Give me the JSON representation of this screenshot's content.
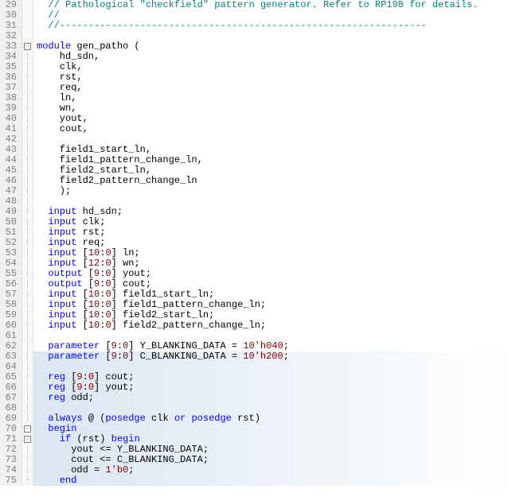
{
  "lines": [
    {
      "n": 29,
      "fold": "",
      "segs": [
        {
          "cls": "comment",
          "t": "  // Pathological \"checkfield\" pattern generator. Refer to RP198 for details."
        }
      ]
    },
    {
      "n": 30,
      "fold": "",
      "segs": [
        {
          "cls": "comment",
          "t": "  //"
        }
      ]
    },
    {
      "n": 31,
      "fold": "",
      "segs": [
        {
          "cls": "comment",
          "t": "  //----------------------------------------------------------------"
        }
      ]
    },
    {
      "n": 32,
      "fold": "",
      "segs": [
        {
          "cls": "",
          "t": ""
        }
      ]
    },
    {
      "n": 33,
      "fold": "minus",
      "segs": [
        {
          "cls": "keyword",
          "t": "module"
        },
        {
          "cls": "ident",
          "t": " gen_patho ("
        }
      ]
    },
    {
      "n": 34,
      "fold": "bar",
      "segs": [
        {
          "cls": "ident",
          "t": "    hd_sdn,"
        }
      ]
    },
    {
      "n": 35,
      "fold": "bar",
      "segs": [
        {
          "cls": "ident",
          "t": "    clk,"
        }
      ]
    },
    {
      "n": 36,
      "fold": "bar",
      "segs": [
        {
          "cls": "ident",
          "t": "    rst,"
        }
      ]
    },
    {
      "n": 37,
      "fold": "bar",
      "segs": [
        {
          "cls": "ident",
          "t": "    req,"
        }
      ]
    },
    {
      "n": 38,
      "fold": "bar",
      "segs": [
        {
          "cls": "ident",
          "t": "    ln,"
        }
      ]
    },
    {
      "n": 39,
      "fold": "bar",
      "segs": [
        {
          "cls": "ident",
          "t": "    wn,"
        }
      ]
    },
    {
      "n": 40,
      "fold": "bar",
      "segs": [
        {
          "cls": "ident",
          "t": "    yout,"
        }
      ]
    },
    {
      "n": 41,
      "fold": "bar",
      "segs": [
        {
          "cls": "ident",
          "t": "    cout,"
        }
      ]
    },
    {
      "n": 42,
      "fold": "bar",
      "segs": [
        {
          "cls": "",
          "t": ""
        }
      ]
    },
    {
      "n": 43,
      "fold": "bar",
      "segs": [
        {
          "cls": "ident",
          "t": "    field1_start_ln,"
        }
      ]
    },
    {
      "n": 44,
      "fold": "bar",
      "segs": [
        {
          "cls": "ident",
          "t": "    field1_pattern_change_ln,"
        }
      ]
    },
    {
      "n": 45,
      "fold": "bar",
      "segs": [
        {
          "cls": "ident",
          "t": "    field2_start_ln,"
        }
      ]
    },
    {
      "n": 46,
      "fold": "bar",
      "segs": [
        {
          "cls": "ident",
          "t": "    field2_pattern_change_ln"
        }
      ]
    },
    {
      "n": 47,
      "fold": "bar",
      "segs": [
        {
          "cls": "ident",
          "t": "    );"
        }
      ]
    },
    {
      "n": 48,
      "fold": "bar",
      "segs": [
        {
          "cls": "",
          "t": ""
        }
      ]
    },
    {
      "n": 49,
      "fold": "bar",
      "segs": [
        {
          "cls": "keyword",
          "t": "  input"
        },
        {
          "cls": "ident",
          "t": " hd_sdn;"
        }
      ]
    },
    {
      "n": 50,
      "fold": "bar",
      "segs": [
        {
          "cls": "keyword",
          "t": "  input"
        },
        {
          "cls": "ident",
          "t": " clk;"
        }
      ]
    },
    {
      "n": 51,
      "fold": "bar",
      "segs": [
        {
          "cls": "keyword",
          "t": "  input"
        },
        {
          "cls": "ident",
          "t": " rst;"
        }
      ]
    },
    {
      "n": 52,
      "fold": "bar",
      "segs": [
        {
          "cls": "keyword",
          "t": "  input"
        },
        {
          "cls": "ident",
          "t": " req;"
        }
      ]
    },
    {
      "n": 53,
      "fold": "bar",
      "segs": [
        {
          "cls": "keyword",
          "t": "  input"
        },
        {
          "cls": "ident",
          "t": " ["
        },
        {
          "cls": "number",
          "t": "10"
        },
        {
          "cls": "ident",
          "t": ":"
        },
        {
          "cls": "number",
          "t": "0"
        },
        {
          "cls": "ident",
          "t": "] ln;"
        }
      ]
    },
    {
      "n": 54,
      "fold": "bar",
      "segs": [
        {
          "cls": "keyword",
          "t": "  input"
        },
        {
          "cls": "ident",
          "t": " ["
        },
        {
          "cls": "number",
          "t": "12"
        },
        {
          "cls": "ident",
          "t": ":"
        },
        {
          "cls": "number",
          "t": "0"
        },
        {
          "cls": "ident",
          "t": "] wn;"
        }
      ]
    },
    {
      "n": 55,
      "fold": "bar",
      "segs": [
        {
          "cls": "keyword",
          "t": "  output"
        },
        {
          "cls": "ident",
          "t": " ["
        },
        {
          "cls": "number",
          "t": "9"
        },
        {
          "cls": "ident",
          "t": ":"
        },
        {
          "cls": "number",
          "t": "0"
        },
        {
          "cls": "ident",
          "t": "] yout;"
        }
      ]
    },
    {
      "n": 56,
      "fold": "bar",
      "segs": [
        {
          "cls": "keyword",
          "t": "  output"
        },
        {
          "cls": "ident",
          "t": " ["
        },
        {
          "cls": "number",
          "t": "9"
        },
        {
          "cls": "ident",
          "t": ":"
        },
        {
          "cls": "number",
          "t": "0"
        },
        {
          "cls": "ident",
          "t": "] cout;"
        }
      ]
    },
    {
      "n": 57,
      "fold": "bar",
      "segs": [
        {
          "cls": "keyword",
          "t": "  input"
        },
        {
          "cls": "ident",
          "t": " ["
        },
        {
          "cls": "number",
          "t": "10"
        },
        {
          "cls": "ident",
          "t": ":"
        },
        {
          "cls": "number",
          "t": "0"
        },
        {
          "cls": "ident",
          "t": "] field1_start_ln;"
        }
      ]
    },
    {
      "n": 58,
      "fold": "bar",
      "segs": [
        {
          "cls": "keyword",
          "t": "  input"
        },
        {
          "cls": "ident",
          "t": " ["
        },
        {
          "cls": "number",
          "t": "10"
        },
        {
          "cls": "ident",
          "t": ":"
        },
        {
          "cls": "number",
          "t": "0"
        },
        {
          "cls": "ident",
          "t": "] field1_pattern_change_ln;"
        }
      ]
    },
    {
      "n": 59,
      "fold": "bar",
      "segs": [
        {
          "cls": "keyword",
          "t": "  input"
        },
        {
          "cls": "ident",
          "t": " ["
        },
        {
          "cls": "number",
          "t": "10"
        },
        {
          "cls": "ident",
          "t": ":"
        },
        {
          "cls": "number",
          "t": "0"
        },
        {
          "cls": "ident",
          "t": "] field2_start_ln;"
        }
      ]
    },
    {
      "n": 60,
      "fold": "bar",
      "segs": [
        {
          "cls": "keyword",
          "t": "  input"
        },
        {
          "cls": "ident",
          "t": " ["
        },
        {
          "cls": "number",
          "t": "10"
        },
        {
          "cls": "ident",
          "t": ":"
        },
        {
          "cls": "number",
          "t": "0"
        },
        {
          "cls": "ident",
          "t": "] field2_pattern_change_ln;"
        }
      ]
    },
    {
      "n": 61,
      "fold": "bar",
      "segs": [
        {
          "cls": "",
          "t": ""
        }
      ]
    },
    {
      "n": 62,
      "fold": "bar",
      "segs": [
        {
          "cls": "keyword",
          "t": "  parameter"
        },
        {
          "cls": "ident",
          "t": " ["
        },
        {
          "cls": "number",
          "t": "9"
        },
        {
          "cls": "ident",
          "t": ":"
        },
        {
          "cls": "number",
          "t": "0"
        },
        {
          "cls": "ident",
          "t": "] Y_BLANKING_DATA = "
        },
        {
          "cls": "number",
          "t": "10'h040"
        },
        {
          "cls": "ident",
          "t": ";"
        }
      ]
    },
    {
      "n": 63,
      "fold": "bar",
      "hl": true,
      "segs": [
        {
          "cls": "keyword",
          "t": "  parameter"
        },
        {
          "cls": "ident",
          "t": " ["
        },
        {
          "cls": "number",
          "t": "9"
        },
        {
          "cls": "ident",
          "t": ":"
        },
        {
          "cls": "number",
          "t": "0"
        },
        {
          "cls": "ident",
          "t": "] C_BLANKING_DATA = "
        },
        {
          "cls": "number",
          "t": "10'h200"
        },
        {
          "cls": "ident",
          "t": ";"
        }
      ]
    },
    {
      "n": 64,
      "fold": "bar",
      "hl": true,
      "segs": [
        {
          "cls": "",
          "t": ""
        }
      ]
    },
    {
      "n": 65,
      "fold": "bar",
      "hl": true,
      "segs": [
        {
          "cls": "keyword",
          "t": "  reg"
        },
        {
          "cls": "ident",
          "t": " ["
        },
        {
          "cls": "number",
          "t": "9"
        },
        {
          "cls": "ident",
          "t": ":"
        },
        {
          "cls": "number",
          "t": "0"
        },
        {
          "cls": "ident",
          "t": "] cout;"
        }
      ]
    },
    {
      "n": 66,
      "fold": "bar",
      "hl": true,
      "segs": [
        {
          "cls": "keyword",
          "t": "  reg"
        },
        {
          "cls": "ident",
          "t": " ["
        },
        {
          "cls": "number",
          "t": "9"
        },
        {
          "cls": "ident",
          "t": ":"
        },
        {
          "cls": "number",
          "t": "0"
        },
        {
          "cls": "ident",
          "t": "] yout;"
        }
      ]
    },
    {
      "n": 67,
      "fold": "bar",
      "hl": true,
      "segs": [
        {
          "cls": "keyword",
          "t": "  reg"
        },
        {
          "cls": "ident",
          "t": " odd;"
        }
      ]
    },
    {
      "n": 68,
      "fold": "bar",
      "hl": true,
      "segs": [
        {
          "cls": "",
          "t": ""
        }
      ]
    },
    {
      "n": 69,
      "fold": "bar",
      "hl": true,
      "segs": [
        {
          "cls": "keyword",
          "t": "  always"
        },
        {
          "cls": "ident",
          "t": " @ ("
        },
        {
          "cls": "keyword",
          "t": "posedge"
        },
        {
          "cls": "ident",
          "t": " clk "
        },
        {
          "cls": "keyword",
          "t": "or"
        },
        {
          "cls": "ident",
          "t": " "
        },
        {
          "cls": "keyword",
          "t": "posedge"
        },
        {
          "cls": "ident",
          "t": " rst)"
        }
      ]
    },
    {
      "n": 70,
      "fold": "minus",
      "hl": true,
      "segs": [
        {
          "cls": "keyword",
          "t": "  begin"
        }
      ]
    },
    {
      "n": 71,
      "fold": "minus",
      "hl": true,
      "segs": [
        {
          "cls": "keyword",
          "t": "    if"
        },
        {
          "cls": "ident",
          "t": " (rst) "
        },
        {
          "cls": "keyword",
          "t": "begin"
        }
      ]
    },
    {
      "n": 72,
      "fold": "bar",
      "hl": true,
      "segs": [
        {
          "cls": "ident",
          "t": "      yout <= Y_BLANKING_DATA;"
        }
      ]
    },
    {
      "n": 73,
      "fold": "bar",
      "hl": true,
      "segs": [
        {
          "cls": "ident",
          "t": "      cout <= C_BLANKING_DATA;"
        }
      ]
    },
    {
      "n": 74,
      "fold": "bar",
      "hl": true,
      "segs": [
        {
          "cls": "ident",
          "t": "      odd = "
        },
        {
          "cls": "number",
          "t": "1'b0"
        },
        {
          "cls": "ident",
          "t": ";"
        }
      ]
    },
    {
      "n": 75,
      "fold": "end",
      "hl": true,
      "segs": [
        {
          "cls": "keyword",
          "t": "    end"
        }
      ]
    }
  ]
}
